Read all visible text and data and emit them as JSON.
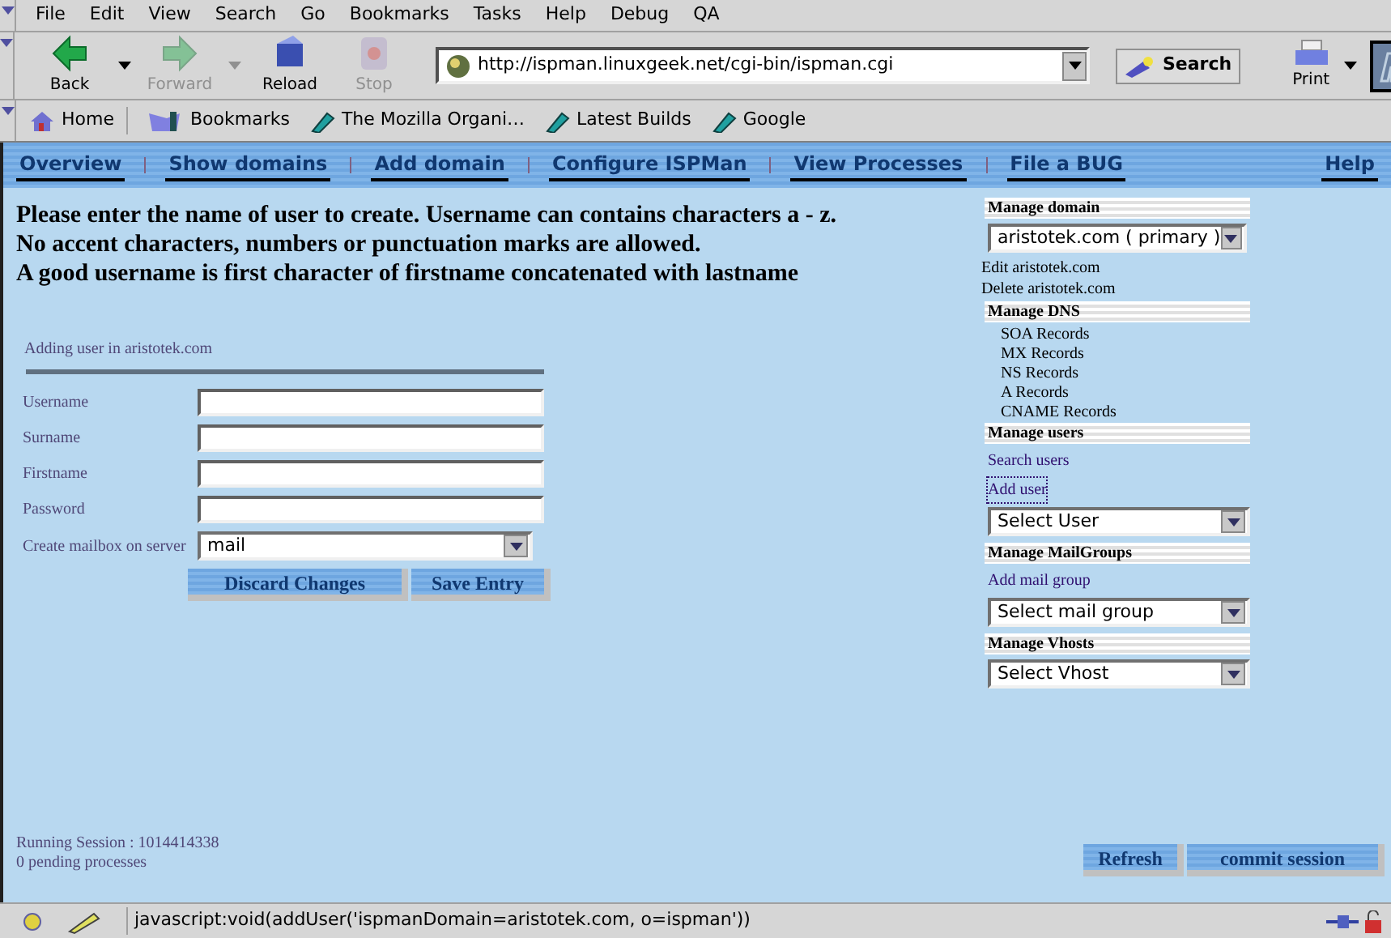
{
  "menu": [
    "File",
    "Edit",
    "View",
    "Search",
    "Go",
    "Bookmarks",
    "Tasks",
    "Help",
    "Debug",
    "QA"
  ],
  "nav_buttons": [
    {
      "label": "Back",
      "kind": "back",
      "disabled": false,
      "dropdown": true
    },
    {
      "label": "Forward",
      "kind": "forward",
      "disabled": true,
      "dropdown": true
    },
    {
      "label": "Reload",
      "kind": "reload",
      "disabled": false,
      "dropdown": false
    },
    {
      "label": "Stop",
      "kind": "stop",
      "disabled": true,
      "dropdown": false
    }
  ],
  "url": "http://ispman.linuxgeek.net/cgi-bin/ispman.cgi",
  "search_label": "Search",
  "print_label": "Print",
  "bookmarks": [
    {
      "label": "Home",
      "kind": "home"
    },
    {
      "label": "Bookmarks",
      "kind": "folder"
    },
    {
      "label": "The Mozilla Organi…",
      "kind": "link"
    },
    {
      "label": "Latest Builds",
      "kind": "link"
    },
    {
      "label": "Google",
      "kind": "link"
    }
  ],
  "top_nav": [
    "Overview",
    "Show domains",
    "Add domain",
    "Configure ISPMan",
    "View Processes",
    "File a BUG"
  ],
  "help": "Help",
  "intro": [
    "Please enter the name of user to create. Username can contains characters a - z.",
    "No accent characters, numbers or punctuation marks are allowed.",
    "A good username is first character of firstname concatenated with lastname"
  ],
  "form": {
    "caption": "Adding user in aristotek.com",
    "fields": [
      {
        "label": "Username",
        "kind": "text"
      },
      {
        "label": "Surname",
        "kind": "text"
      },
      {
        "label": "Firstname",
        "kind": "text"
      },
      {
        "label": "Password",
        "kind": "text"
      },
      {
        "label": "Create mailbox on server",
        "kind": "select",
        "value": "mail"
      }
    ],
    "buttons": [
      "Discard Changes",
      "Save Entry"
    ]
  },
  "sidebar": [
    {
      "title": "Manage domain",
      "items": [
        {
          "kind": "select",
          "text": "aristotek.com ( primary )"
        },
        {
          "kind": "plain",
          "text": "Edit aristotek.com"
        },
        {
          "kind": "plain",
          "text": "Delete aristotek.com"
        }
      ]
    },
    {
      "title": "Manage DNS",
      "items": [
        {
          "kind": "indented",
          "text": "SOA Records"
        },
        {
          "kind": "indented",
          "text": "MX Records"
        },
        {
          "kind": "indented",
          "text": "NS Records"
        },
        {
          "kind": "indented",
          "text": "A Records"
        },
        {
          "kind": "indented",
          "text": "CNAME Records"
        }
      ]
    },
    {
      "title": "Manage users",
      "items": [
        {
          "kind": "link",
          "text": "Search users",
          "focused": false
        },
        {
          "kind": "link",
          "text": "Add user",
          "focused": true
        },
        {
          "kind": "select",
          "text": "Select User"
        }
      ]
    },
    {
      "title": "Manage MailGroups",
      "items": [
        {
          "kind": "link",
          "text": "Add mail group",
          "focused": false
        },
        {
          "kind": "select",
          "text": "Select mail group"
        }
      ]
    },
    {
      "title": "Manage Vhosts",
      "items": [
        {
          "kind": "select",
          "text": "Select Vhost"
        }
      ]
    }
  ],
  "session": [
    "Running Session : 1014414338",
    "0 pending processes"
  ],
  "footer_buttons": [
    "Refresh",
    "commit session"
  ],
  "status": "javascript:void(addUser('ispmanDomain=aristotek.com, o=ispman'))"
}
